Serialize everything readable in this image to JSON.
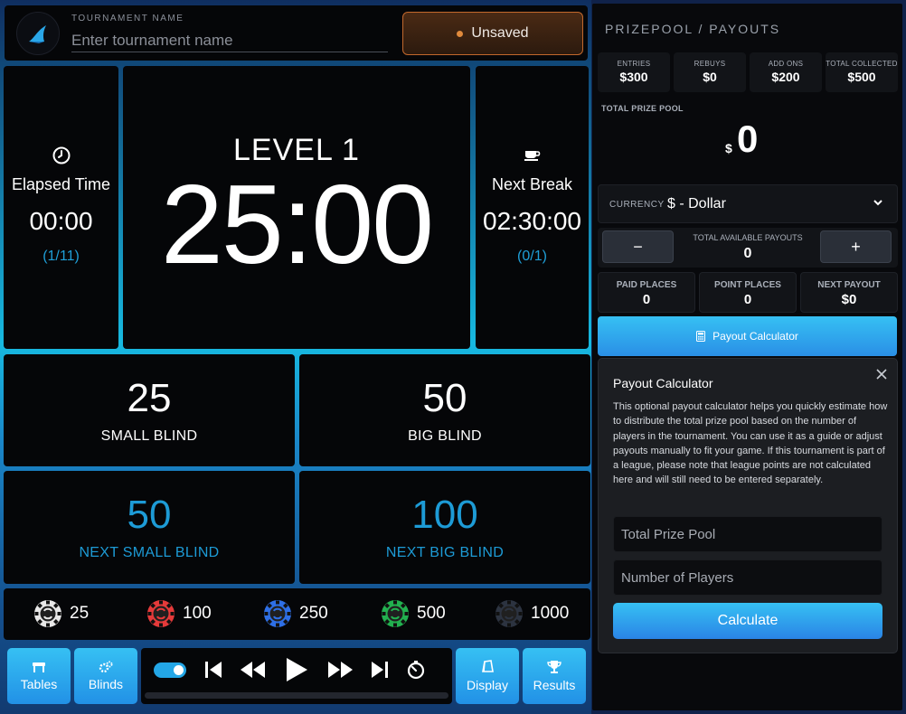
{
  "header": {
    "tournament_label": "TOURNAMENT NAME",
    "tournament_placeholder": "Enter tournament name",
    "tournament_value": "",
    "status": "Unsaved",
    "status_color": "#e08a3c"
  },
  "clock": {
    "elapsed_title": "Elapsed Time",
    "elapsed_time": "00:00",
    "elapsed_count": "(1/11)",
    "level": "LEVEL 1",
    "time_remaining": "25:00",
    "break_title": "Next Break",
    "break_time": "02:30:00",
    "break_count": "(0/1)"
  },
  "blinds": {
    "small_value": "25",
    "small_label": "SMALL BLIND",
    "big_value": "50",
    "big_label": "BIG BLIND",
    "next_small_value": "50",
    "next_small_label": "NEXT SMALL BLIND",
    "next_big_value": "100",
    "next_big_label": "NEXT BIG BLIND"
  },
  "chips": [
    {
      "value": "25",
      "color": "#e8e8e8"
    },
    {
      "value": "100",
      "color": "#e53a3a"
    },
    {
      "value": "250",
      "color": "#2e6fe6"
    },
    {
      "value": "500",
      "color": "#22b04f"
    },
    {
      "value": "1000",
      "color": "#2c3340"
    }
  ],
  "controls": {
    "tables": "Tables",
    "blinds": "Blinds",
    "display": "Display",
    "results": "Results",
    "icons": [
      "skip-start-icon",
      "rewind-icon",
      "play-icon",
      "fast-forward-icon",
      "skip-end-icon",
      "timer-icon"
    ]
  },
  "prizepool": {
    "title": "PRIZEPOOL / PAYOUTS",
    "stats": [
      {
        "label": "ENTRIES",
        "value": "$300"
      },
      {
        "label": "REBUYS",
        "value": "$0"
      },
      {
        "label": "ADD ONS",
        "value": "$200"
      },
      {
        "label": "TOTAL COLLECTED",
        "value": "$500"
      }
    ],
    "total_label": "TOTAL PRIZE POOL",
    "total_currency": "$",
    "total_value": "0",
    "currency_label": "CURRENCY",
    "currency_value": "$ - Dollar",
    "available_label": "TOTAL AVAILABLE PAYOUTS",
    "available_value": "0",
    "minus": "−",
    "plus": "+",
    "places": [
      {
        "label": "PAID PLACES",
        "value": "0"
      },
      {
        "label": "POINT PLACES",
        "value": "0"
      },
      {
        "label": "NEXT PAYOUT",
        "value": "$0"
      }
    ],
    "calculator_button": "Payout Calculator"
  },
  "calculator": {
    "title": "Payout Calculator",
    "description": "This optional payout calculator helps you quickly estimate how to distribute the total prize pool based on the number of players in the tournament. You can use it as a guide or adjust payouts manually to fit your game. If this tournament is part of a league, please note that league points are not calculated here and will still need to be entered separately.",
    "prize_placeholder": "Total Prize Pool",
    "players_placeholder": "Number of Players",
    "submit": "Calculate"
  }
}
